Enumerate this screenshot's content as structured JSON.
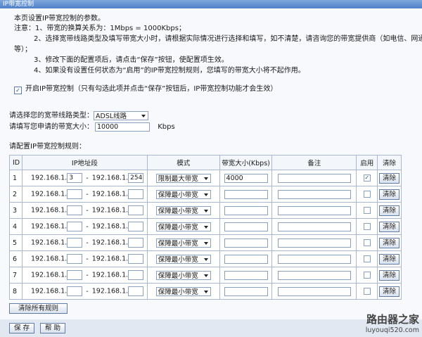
{
  "title": "IP带宽控制",
  "notes": {
    "l1": "本页设置IP带宽控制的参数。",
    "l2": "注意：1、带宽的换算关系为：1Mbps = 1000Kbps；",
    "l3": "2、选择宽带线路类型及填写带宽大小时，请根据实际情况进行选择和填写，如不清楚，请咨询您的带宽提供商（如电信、网通",
    "l4": "等）；",
    "l5": "3、修改下面的配置项后，请点击“保存”按钮，使配置项生效。",
    "l6": "4、如果没有设置任何状态为“启用”的IP带宽控制规则，您填写的带宽大小将不起作用。"
  },
  "enable_label": "开启IP带宽控制（只有勾选此项并点击“保存”按钮后，IP带宽控制功能才会生效）",
  "enable_checked": true,
  "line_type": {
    "label": "请选择您的宽带线路类型：",
    "value": "ADSL线路"
  },
  "bandwidth": {
    "label": "请填写您申请的带宽大小：",
    "value": "10000",
    "unit": "Kbps"
  },
  "rules_label": "请配置IP带宽控制规则：",
  "columns": {
    "id": "ID",
    "ip": "IP地址段",
    "mode": "模式",
    "bw": "带宽大小(Kbps)",
    "remark": "备注",
    "enable": "启用",
    "clear": "清除"
  },
  "ip_prefix": "192.168.1.",
  "ip_sep": "-",
  "clear_label": "清除",
  "rows": [
    {
      "id": "1",
      "start": "3",
      "end": "254",
      "mode": "限制最大带宽",
      "bw": "4000",
      "enabled": true
    },
    {
      "id": "2",
      "start": "",
      "end": "",
      "mode": "保障最小带宽",
      "bw": "",
      "enabled": false
    },
    {
      "id": "3",
      "start": "",
      "end": "",
      "mode": "保障最小带宽",
      "bw": "",
      "enabled": false
    },
    {
      "id": "4",
      "start": "",
      "end": "",
      "mode": "保障最小带宽",
      "bw": "",
      "enabled": false
    },
    {
      "id": "5",
      "start": "",
      "end": "",
      "mode": "保障最小带宽",
      "bw": "",
      "enabled": false
    },
    {
      "id": "6",
      "start": "",
      "end": "",
      "mode": "保障最小带宽",
      "bw": "",
      "enabled": false
    },
    {
      "id": "7",
      "start": "",
      "end": "",
      "mode": "保障最小带宽",
      "bw": "",
      "enabled": false
    },
    {
      "id": "8",
      "start": "",
      "end": "",
      "mode": "保障最小带宽",
      "bw": "",
      "enabled": false
    }
  ],
  "clear_all_label": "清除所有规则",
  "save_label": "保 存",
  "help_label": "帮 助",
  "watermark": {
    "line1": "路由器之家",
    "line2": "luyouqi520.com"
  }
}
